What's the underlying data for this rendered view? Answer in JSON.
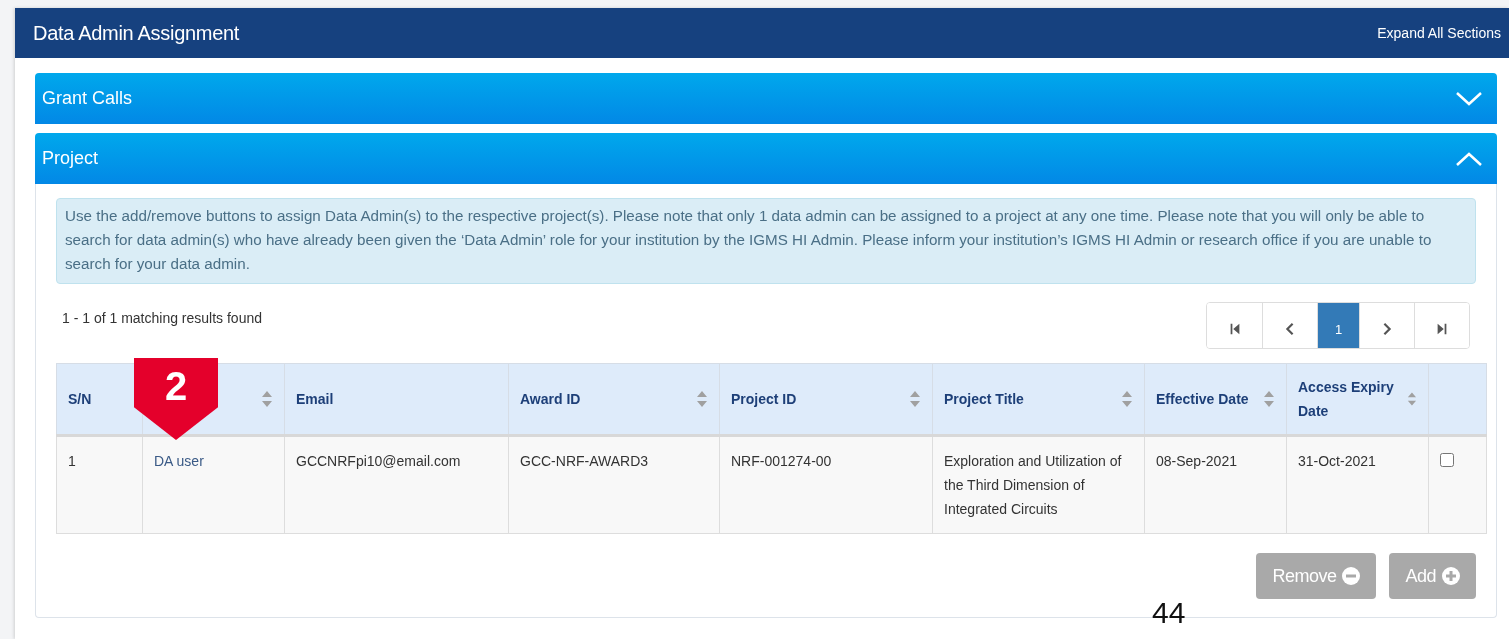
{
  "window": {
    "title": "Data Admin Assignment",
    "expand_all": "Expand All Sections"
  },
  "sections": [
    {
      "title": "Grant Calls",
      "expanded": false
    },
    {
      "title": "Project",
      "expanded": true
    }
  ],
  "info": "Use the add/remove buttons to assign Data Admin(s) to the respective project(s). Please note that only 1 data admin can be assigned to a project at any one time. Please note that you will only be able to search for data admin(s) who have already been given the ‘Data Admin’ role for your institution by the IGMS HI Admin. Please inform your institution’s IGMS HI Admin or research office if you are unable to search for your data admin.",
  "results_count": "1 - 1 of 1 matching results found",
  "pager": [
    {
      "kind": "first"
    },
    {
      "kind": "prev"
    },
    {
      "kind": "page",
      "label": "1",
      "selected": true
    },
    {
      "kind": "next"
    },
    {
      "kind": "last"
    }
  ],
  "table": {
    "columns": [
      {
        "label": "S/N",
        "sortable": false
      },
      {
        "sortable": true
      },
      {
        "label": "Email",
        "sortable": false
      },
      {
        "label": "Award ID",
        "sortable": true
      },
      {
        "label": "Project ID",
        "sortable": true
      },
      {
        "label": "Project Title",
        "sortable": true
      },
      {
        "label": "Effective Date",
        "sortable": true
      },
      {
        "label": "Access Expiry Date",
        "sortable": true
      }
    ],
    "rows": [
      {
        "cells": [
          "1",
          "DA user",
          "GCCNRFpi10@email.com",
          "GCC-NRF-AWARD3",
          "NRF-001274-00",
          "Exploration and Utilization of the Third Dimension of Integrated Circuits",
          "08-Sep-2021",
          "31-Oct-2021"
        ],
        "checked": false
      }
    ]
  },
  "buttons": [
    {
      "label": "Remove",
      "kind": "remove",
      "disabled": true
    },
    {
      "label": "Add",
      "kind": "add",
      "disabled": true
    }
  ],
  "callout": "2",
  "page_number": "44"
}
